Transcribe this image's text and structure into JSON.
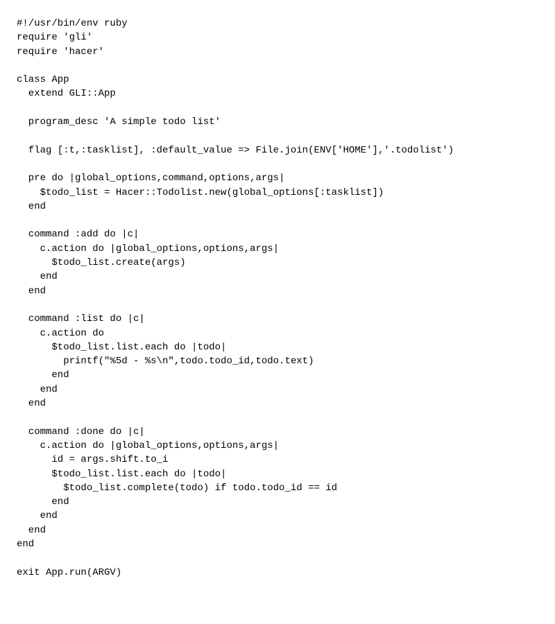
{
  "code": {
    "lines": [
      "#!/usr/bin/env ruby",
      "require 'gli'",
      "require 'hacer'",
      "",
      "class App",
      "  extend GLI::App",
      "",
      "  program_desc 'A simple todo list'",
      "",
      "  flag [:t,:tasklist], :default_value => File.join(ENV['HOME'],'.todolist')",
      "",
      "  pre do |global_options,command,options,args|",
      "    $todo_list = Hacer::Todolist.new(global_options[:tasklist])",
      "  end",
      "",
      "  command :add do |c|",
      "    c.action do |global_options,options,args|",
      "      $todo_list.create(args)",
      "    end",
      "  end",
      "",
      "  command :list do |c|",
      "    c.action do",
      "      $todo_list.list.each do |todo|",
      "        printf(\"%5d - %s\\n\",todo.todo_id,todo.text)",
      "      end",
      "    end",
      "  end",
      "",
      "  command :done do |c|",
      "    c.action do |global_options,options,args|",
      "      id = args.shift.to_i",
      "      $todo_list.list.each do |todo|",
      "        $todo_list.complete(todo) if todo.todo_id == id",
      "      end",
      "    end",
      "  end",
      "end",
      "",
      "exit App.run(ARGV)"
    ]
  }
}
